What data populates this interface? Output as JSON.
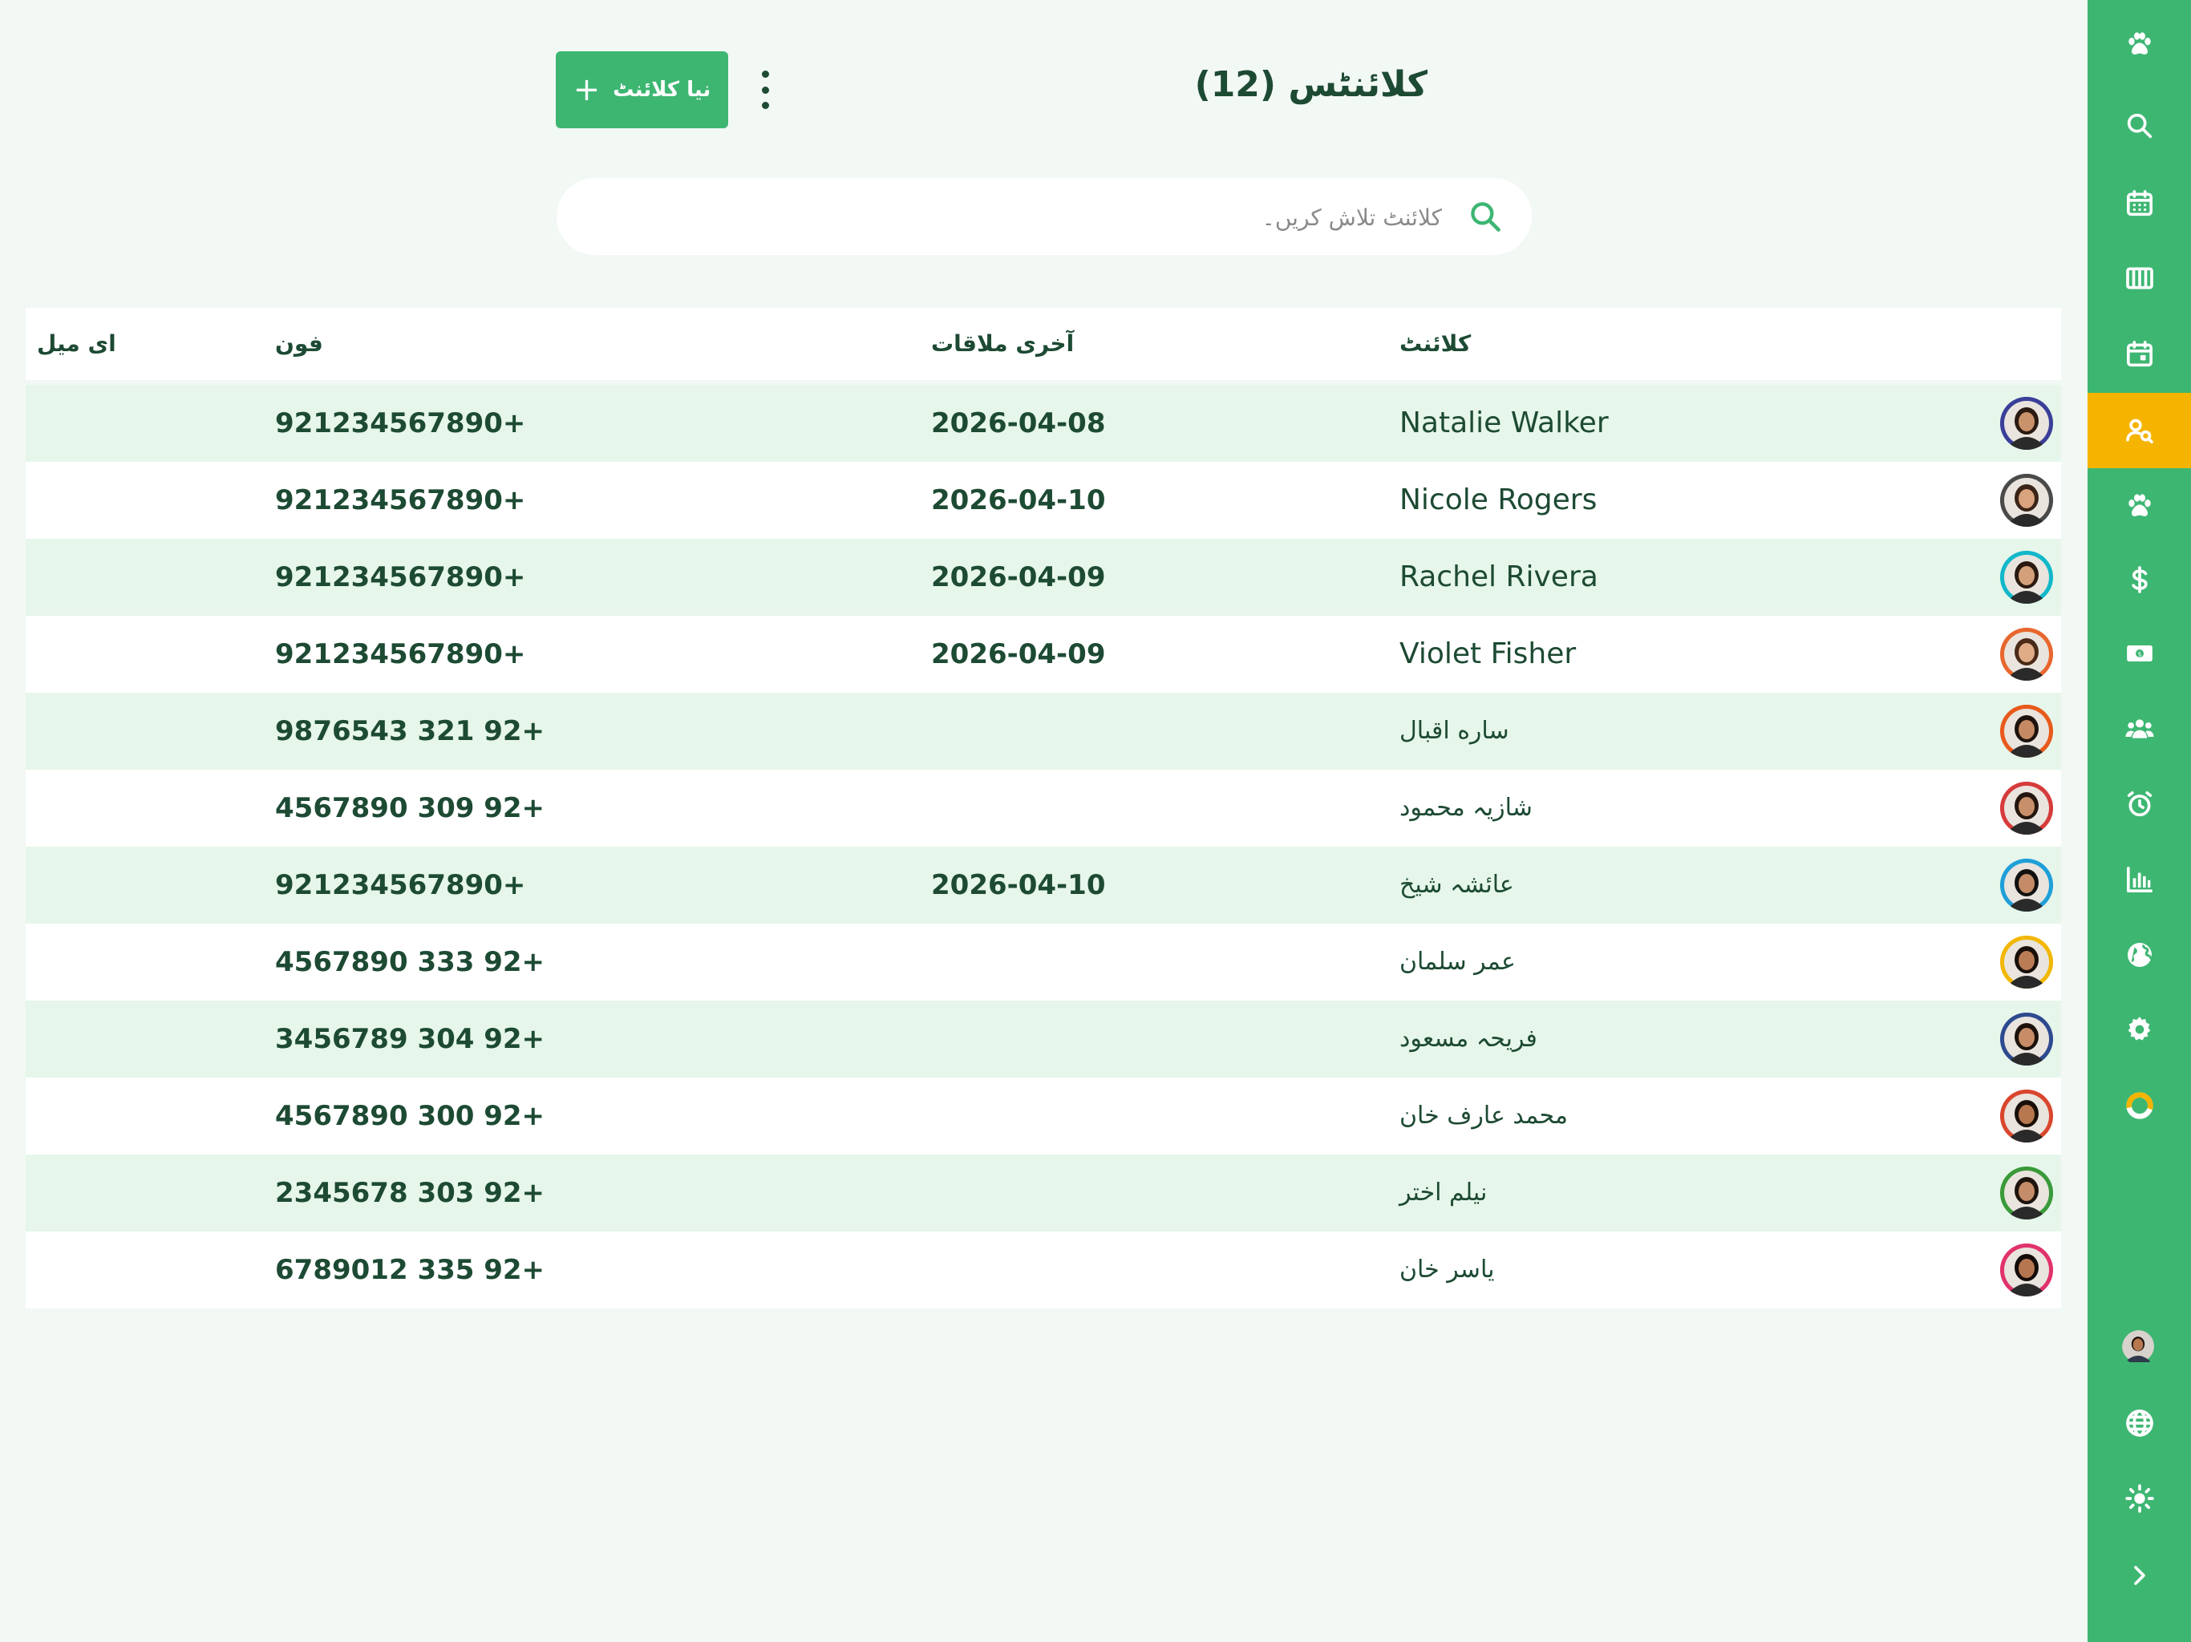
{
  "header": {
    "title": "کلائنٹس (12)",
    "new_client_label": "نیا کلائنٹ",
    "new_client_icon": "plus-icon",
    "more_icon": "kebab-icon"
  },
  "search": {
    "placeholder": "کلائنٹ تلاش کریں۔",
    "value": "",
    "icon": "search-icon"
  },
  "table": {
    "columns": {
      "client": "کلائنٹ",
      "last_appointment": "آخری ملاقات",
      "phone": "فون",
      "email": "ای میل"
    },
    "rows": [
      {
        "name": "Natalie Walker",
        "last": "2026-04-08",
        "phone": "921234567890+",
        "email": "",
        "ring": "#3b3f99",
        "skin": "#c9926b",
        "hair": "#2b1a12"
      },
      {
        "name": "Nicole Rogers",
        "last": "2026-04-10",
        "phone": "921234567890+",
        "email": "",
        "ring": "#4a4a4a",
        "skin": "#d9a37e",
        "hair": "#3a2418"
      },
      {
        "name": "Rachel Rivera",
        "last": "2026-04-09",
        "phone": "921234567890+",
        "email": "",
        "ring": "#12b8c9",
        "skin": "#d4a07a",
        "hair": "#2a1a10"
      },
      {
        "name": "Violet Fisher",
        "last": "2026-04-09",
        "phone": "921234567890+",
        "email": "",
        "ring": "#e8672e",
        "skin": "#e0ac88",
        "hair": "#4a2a18"
      },
      {
        "name": "ساره اقبال",
        "last": "",
        "phone": "9876543 321 92+",
        "email": "",
        "ring": "#e85a1c",
        "skin": "#c58a63",
        "hair": "#1e120c"
      },
      {
        "name": "شازیہ محمود",
        "last": "",
        "phone": "4567890 309 92+",
        "email": "",
        "ring": "#d63b3b",
        "skin": "#c8906a",
        "hair": "#24160e"
      },
      {
        "name": "عائشہ شیخ",
        "last": "2026-04-10",
        "phone": "921234567890+",
        "email": "",
        "ring": "#1e9fd8",
        "skin": "#c48b66",
        "hair": "#111111"
      },
      {
        "name": "عمر سلمان",
        "last": "",
        "phone": "4567890 333 92+",
        "email": "",
        "ring": "#f2b705",
        "skin": "#b97c55",
        "hair": "#1a100a"
      },
      {
        "name": "فریحہ مسعود",
        "last": "",
        "phone": "3456789 304 92+",
        "email": "",
        "ring": "#2e4a8f",
        "skin": "#c68d67",
        "hair": "#1c120c"
      },
      {
        "name": "محمد عارف خان",
        "last": "",
        "phone": "4567890 300 92+",
        "email": "",
        "ring": "#d9462e",
        "skin": "#b7784f",
        "hair": "#1a100a"
      },
      {
        "name": "نیلم اختر",
        "last": "",
        "phone": "2345678 303 92+",
        "email": "",
        "ring": "#3a9a3a",
        "skin": "#c48c68",
        "hair": "#1e140d"
      },
      {
        "name": "یاسر خان",
        "last": "",
        "phone": "6789012 335 92+",
        "email": "",
        "ring": "#e0336b",
        "skin": "#b57650",
        "hair": "#140c08"
      }
    ]
  },
  "sidebar": {
    "items": [
      {
        "icon": "paw-icon",
        "name": "sidebar-item-home"
      },
      {
        "icon": "search-icon",
        "name": "sidebar-item-search"
      },
      {
        "icon": "calendar-grid-icon",
        "name": "sidebar-item-calendar"
      },
      {
        "icon": "columns-icon",
        "name": "sidebar-item-board"
      },
      {
        "icon": "calendar-day-icon",
        "name": "sidebar-item-appointments"
      },
      {
        "icon": "user-search-icon",
        "name": "sidebar-item-clients",
        "active": true
      },
      {
        "icon": "paw-icon",
        "name": "sidebar-item-pets"
      },
      {
        "icon": "dollar-icon",
        "name": "sidebar-item-sales"
      },
      {
        "icon": "cash-icon",
        "name": "sidebar-item-payments"
      },
      {
        "icon": "users-icon",
        "name": "sidebar-item-staff"
      },
      {
        "icon": "alarm-icon",
        "name": "sidebar-item-reminders"
      },
      {
        "icon": "bar-chart-icon",
        "name": "sidebar-item-reports"
      },
      {
        "icon": "globe-icon",
        "name": "sidebar-item-online"
      },
      {
        "icon": "gear-icon",
        "name": "sidebar-item-settings"
      },
      {
        "icon": "progress-ring-icon",
        "name": "sidebar-item-setup-progress"
      }
    ],
    "bottom": [
      {
        "icon": "user-avatar",
        "name": "sidebar-profile-avatar"
      },
      {
        "icon": "globe-icon",
        "name": "sidebar-language"
      },
      {
        "icon": "sun-icon",
        "name": "sidebar-theme-toggle"
      },
      {
        "icon": "chevron-right-icon",
        "name": "sidebar-expand"
      }
    ]
  },
  "colors": {
    "primary": "#3db672",
    "active": "#f5b400",
    "row_alt": "#e6f6ea",
    "text": "#1d4a33",
    "background": "#f2f8f4"
  }
}
